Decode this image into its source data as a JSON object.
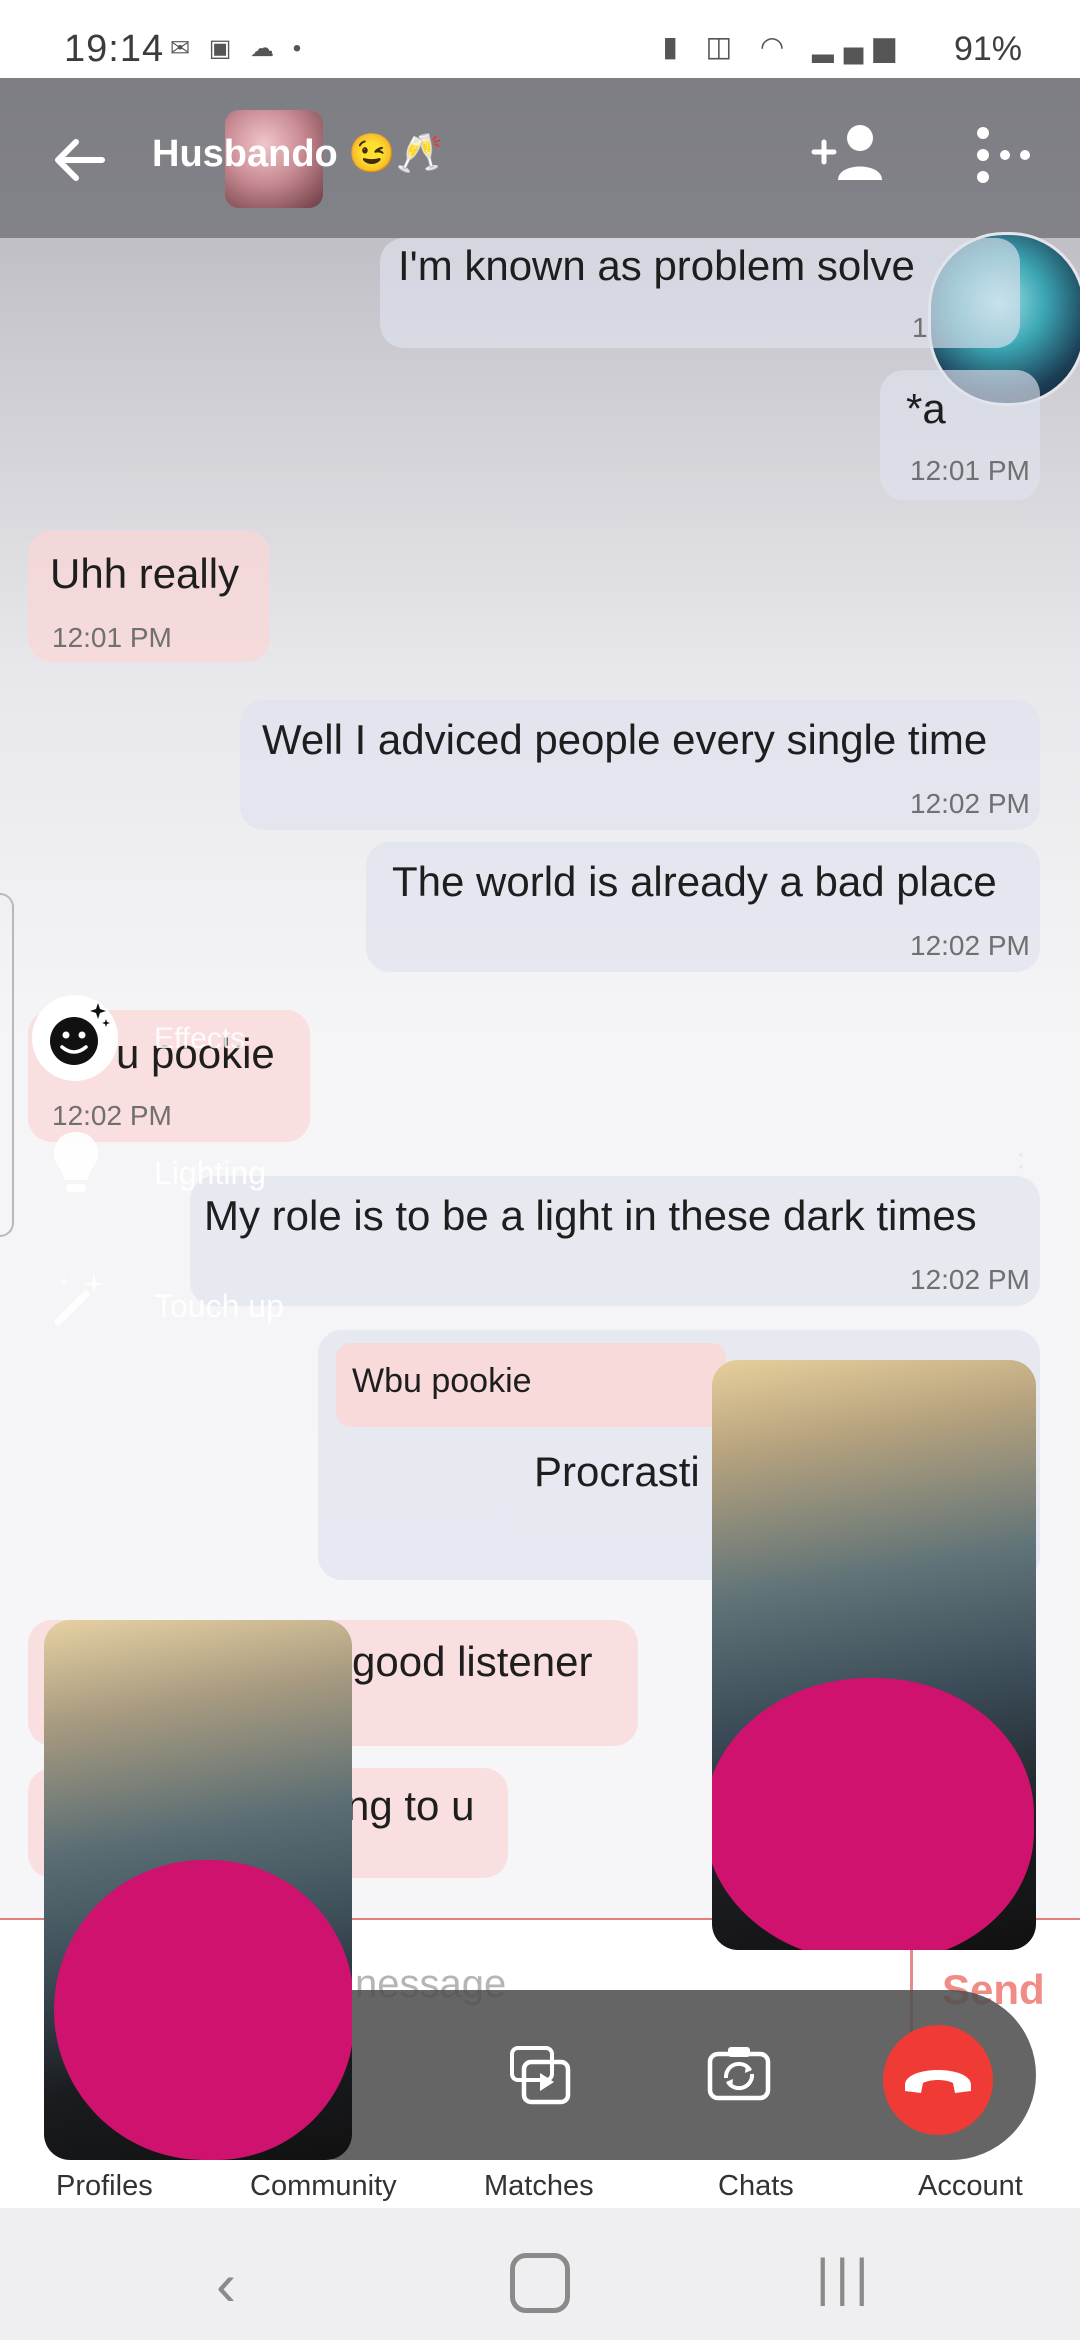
{
  "status_bar": {
    "time": "19:14",
    "battery": "91%",
    "left_icons": [
      "messages-icon",
      "photo-icon",
      "cloud-icon",
      "dot-icon"
    ],
    "right_icons": [
      "battery-saver-icon",
      "vibrate-icon",
      "wifi-icon",
      "signal-icon"
    ]
  },
  "header": {
    "title": "Husbando 😉🥂",
    "icons": [
      "back-arrow-icon",
      "add-friend-icon",
      "more-options-icon"
    ]
  },
  "messages": [
    {
      "side": "out",
      "text": "I'm known as problem solve",
      "time": "1"
    },
    {
      "side": "out",
      "text": "*a",
      "time": "12:01 PM"
    },
    {
      "side": "in",
      "text": "Uhh really",
      "time": "12:01 PM"
    },
    {
      "side": "out",
      "text": "Well I adviced people every single time",
      "time": "12:02 PM"
    },
    {
      "side": "out",
      "text": "The world is already a bad place",
      "time": "12:02 PM"
    },
    {
      "side": "in",
      "text": "u pookie",
      "time": "12:02 PM"
    },
    {
      "side": "out",
      "text": "My role is to be a light in these dark times",
      "time": "12:02 PM"
    },
    {
      "side": "out",
      "quote": "Wbu pookie",
      "text": "Procrasti"
    },
    {
      "side": "in",
      "text": "good listener"
    },
    {
      "side": "in",
      "text": "ng to u"
    }
  ],
  "effects_panel": {
    "effects_label": "Effects",
    "lighting_label": "Lighting",
    "touchup_label": "Touch up"
  },
  "input": {
    "placeholder_visible": "nessage",
    "send_label": "Send"
  },
  "call_controls": [
    "screen-share-icon",
    "switch-camera-icon",
    "end-call-icon"
  ],
  "bottom_nav": [
    "Profiles",
    "Community",
    "Matches",
    "Chats",
    "Account"
  ],
  "colors": {
    "header_overlay": "#6e6e74",
    "incoming_bubble": "#fcd6d6",
    "outgoing_bubble": "#dfe2ee",
    "end_call": "#ef3a36",
    "censor_magenta": "#d0126f",
    "send_text": "#f08b86"
  }
}
